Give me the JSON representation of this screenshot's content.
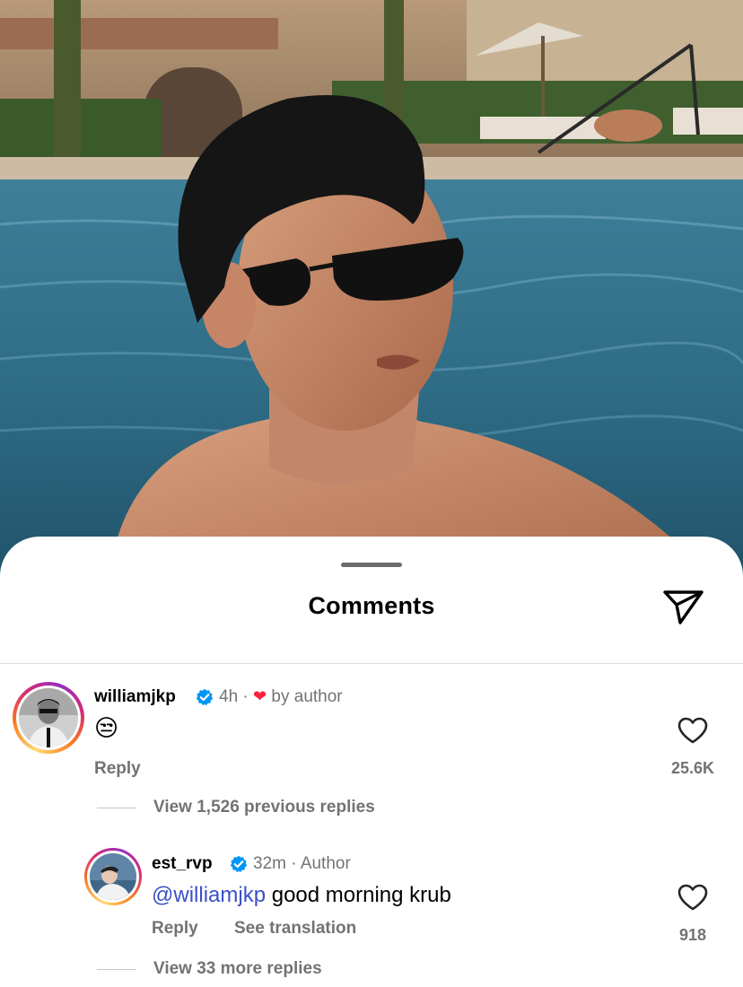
{
  "sheet": {
    "title": "Comments",
    "share_icon": "send-icon"
  },
  "comments": [
    {
      "username": "williamjkp",
      "verified": true,
      "time": "4h",
      "meta_separator": "·",
      "liked_by_author_label": "by author",
      "text": "😒",
      "reply_label": "Reply",
      "like_count": "25.6K",
      "view_replies_label": "View 1,526 previous replies"
    },
    {
      "username": "est_rvp",
      "verified": true,
      "time": "32m",
      "meta_separator": "·",
      "author_tag": "Author",
      "mention": "@williamjkp",
      "text": " good morning krub",
      "reply_label": "Reply",
      "see_translation_label": "See translation",
      "like_count": "918",
      "view_replies_label": "View 33 more replies"
    }
  ],
  "colors": {
    "muted_text": "#737373",
    "mention": "#3b50c8",
    "verified_blue": "#0095f6",
    "heart_red": "#ff1f3d"
  }
}
